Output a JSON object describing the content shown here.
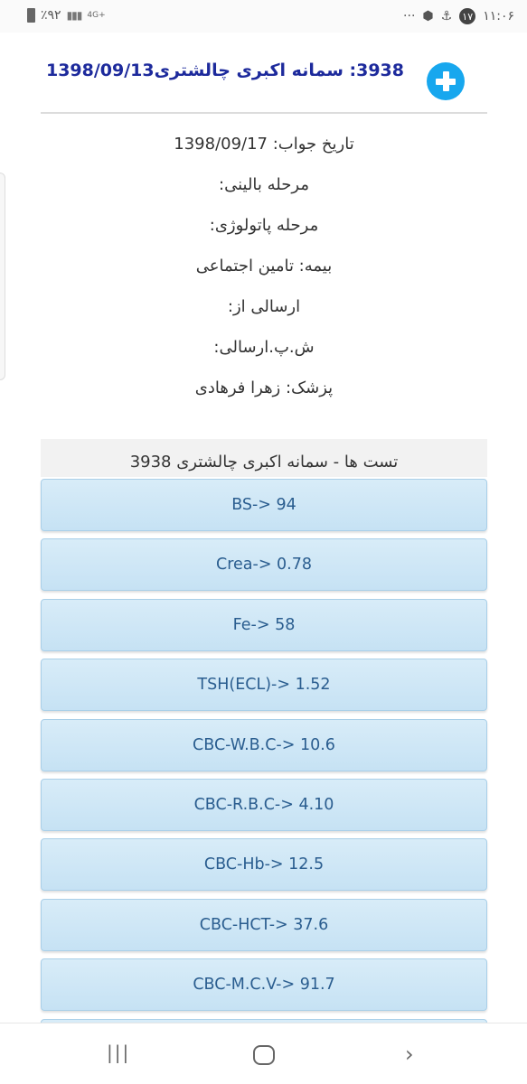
{
  "status_bar": {
    "time": "۱۱:۰۶",
    "notification_count": "۱۷",
    "more": "···",
    "network": "4G+",
    "battery": "٪۹۲"
  },
  "header": {
    "title": "3938: سمانه اکبری چالشتری1398/09/13"
  },
  "info": {
    "answer_date": "تاریخ جواب: 1398/09/17",
    "clinical_stage": "مرحله بالینی:",
    "pathology_stage": "مرحله پاتولوژی:",
    "insurance": "بیمه: تامین اجتماعی",
    "sent_from": "ارسالی از:",
    "sent_number": "ش.پ.ارسالی:",
    "doctor": "پزشک: زهرا فرهادی"
  },
  "tests": {
    "heading": "تست ها - سمانه اکبری چالشتری 3938",
    "items": [
      "BS-> 94",
      "Crea-> 0.78",
      "Fe-> 58",
      "TSH(ECL)-> 1.52",
      "CBC-W.B.C-> 10.6",
      "CBC-R.B.C-> 4.10",
      "CBC-Hb-> 12.5",
      "CBC-HCT-> 37.6",
      "CBC-M.C.V-> 91.7",
      ""
    ]
  },
  "nav": {
    "recent": "|||",
    "back": "›"
  }
}
